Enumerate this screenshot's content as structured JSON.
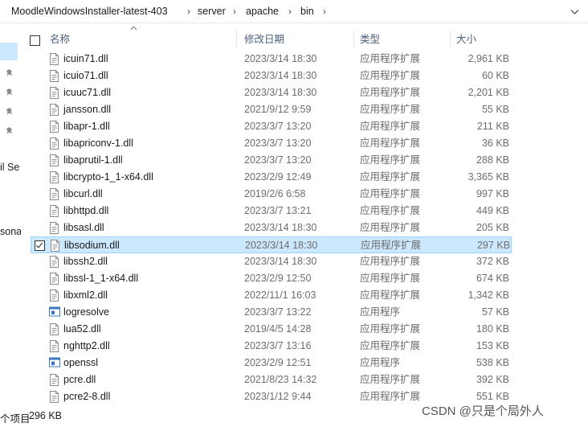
{
  "breadcrumb": {
    "items": [
      "MoodleWindowsInstaller-latest-403",
      "server",
      "apache",
      "bin"
    ],
    "separator": "›"
  },
  "nav": {
    "partial_labels": [
      "il Se",
      "sona"
    ]
  },
  "columns": {
    "name": "名称",
    "date": "修改日期",
    "type": "类型",
    "size": "大小"
  },
  "files": [
    {
      "name": "icuin71.dll",
      "date": "2023/3/14 18:30",
      "type": "应用程序扩展",
      "size": "2,961 KB",
      "icon": "dll-file-icon"
    },
    {
      "name": "icuio71.dll",
      "date": "2023/3/14 18:30",
      "type": "应用程序扩展",
      "size": "60 KB",
      "icon": "dll-file-icon"
    },
    {
      "name": "icuuc71.dll",
      "date": "2023/3/14 18:30",
      "type": "应用程序扩展",
      "size": "2,201 KB",
      "icon": "dll-file-icon"
    },
    {
      "name": "jansson.dll",
      "date": "2021/9/12 9:59",
      "type": "应用程序扩展",
      "size": "55 KB",
      "icon": "dll-file-icon"
    },
    {
      "name": "libapr-1.dll",
      "date": "2023/3/7 13:20",
      "type": "应用程序扩展",
      "size": "211 KB",
      "icon": "dll-file-icon"
    },
    {
      "name": "libapriconv-1.dll",
      "date": "2023/3/7 13:20",
      "type": "应用程序扩展",
      "size": "36 KB",
      "icon": "dll-file-icon"
    },
    {
      "name": "libaprutil-1.dll",
      "date": "2023/3/7 13:20",
      "type": "应用程序扩展",
      "size": "288 KB",
      "icon": "dll-file-icon"
    },
    {
      "name": "libcrypto-1_1-x64.dll",
      "date": "2023/2/9 12:49",
      "type": "应用程序扩展",
      "size": "3,365 KB",
      "icon": "dll-file-icon"
    },
    {
      "name": "libcurl.dll",
      "date": "2019/2/6 6:58",
      "type": "应用程序扩展",
      "size": "997 KB",
      "icon": "dll-file-icon"
    },
    {
      "name": "libhttpd.dll",
      "date": "2023/3/7 13:21",
      "type": "应用程序扩展",
      "size": "449 KB",
      "icon": "dll-file-icon"
    },
    {
      "name": "libsasl.dll",
      "date": "2023/3/14 18:30",
      "type": "应用程序扩展",
      "size": "205 KB",
      "icon": "dll-file-icon"
    },
    {
      "name": "libsodium.dll",
      "date": "2023/3/14 18:30",
      "type": "应用程序扩展",
      "size": "297 KB",
      "icon": "dll-file-icon",
      "selected": true
    },
    {
      "name": "libssh2.dll",
      "date": "2023/3/14 18:30",
      "type": "应用程序扩展",
      "size": "372 KB",
      "icon": "dll-file-icon"
    },
    {
      "name": "libssl-1_1-x64.dll",
      "date": "2023/2/9 12:50",
      "type": "应用程序扩展",
      "size": "674 KB",
      "icon": "dll-file-icon"
    },
    {
      "name": "libxml2.dll",
      "date": "2022/11/1 16:03",
      "type": "应用程序扩展",
      "size": "1,342 KB",
      "icon": "dll-file-icon"
    },
    {
      "name": "logresolve",
      "date": "2023/3/7 13:22",
      "type": "应用程序",
      "size": "57 KB",
      "icon": "exe-file-icon"
    },
    {
      "name": "lua52.dll",
      "date": "2019/4/5 14:28",
      "type": "应用程序扩展",
      "size": "180 KB",
      "icon": "dll-file-icon"
    },
    {
      "name": "nghttp2.dll",
      "date": "2023/3/7 13:16",
      "type": "应用程序扩展",
      "size": "153 KB",
      "icon": "dll-file-icon"
    },
    {
      "name": "openssl",
      "date": "2023/2/9 12:51",
      "type": "应用程序",
      "size": "538 KB",
      "icon": "exe-file-icon"
    },
    {
      "name": "pcre.dll",
      "date": "2021/8/23 14:32",
      "type": "应用程序扩展",
      "size": "392 KB",
      "icon": "dll-file-icon"
    },
    {
      "name": "pcre2-8.dll",
      "date": "2023/1/12 9:44",
      "type": "应用程序扩展",
      "size": "551 KB",
      "icon": "dll-file-icon"
    }
  ],
  "status": {
    "count": "个项目",
    "selected": "296 KB"
  },
  "watermark": "CSDN @只是个局外人",
  "colors": {
    "selection_bg": "#cce8ff",
    "selection_border": "#99d1ff",
    "header_text": "#4c607a",
    "meta_text": "#6d6d6d"
  }
}
